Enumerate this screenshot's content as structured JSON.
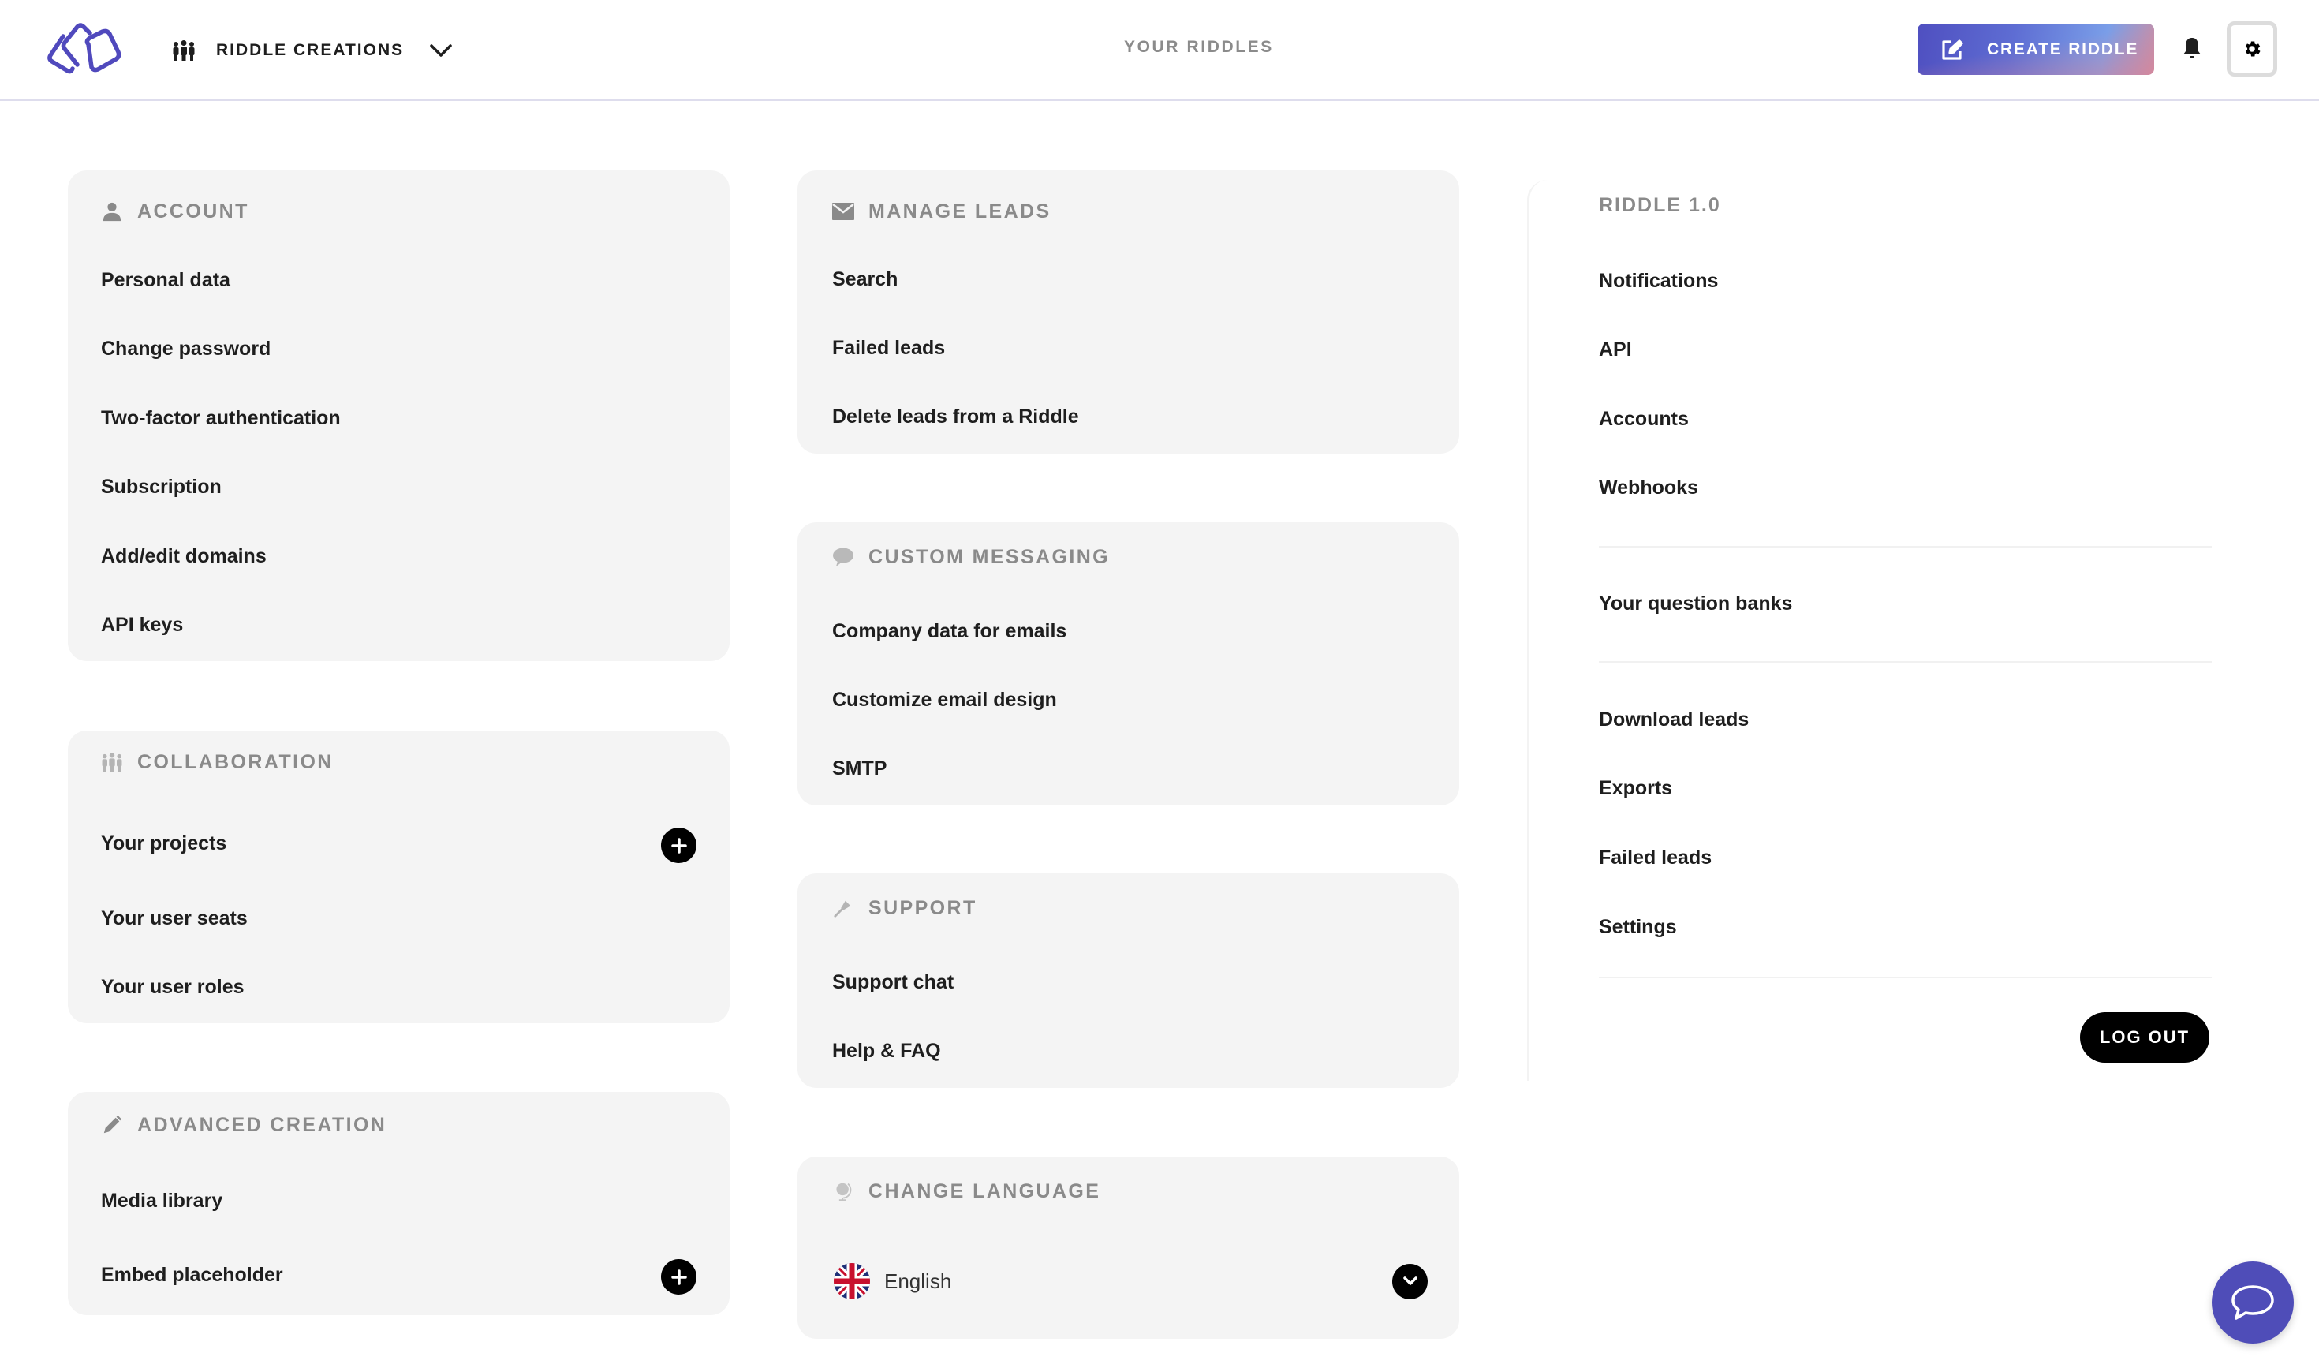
{
  "header": {
    "team_name": "RIDDLE CREATIONS",
    "nav_center": "YOUR RIDDLES",
    "create_button": "CREATE RIDDLE",
    "colors": {
      "brand": "#4f4db8",
      "gradient_start": "#4f4fc0",
      "gradient_end": "#c98fa6"
    }
  },
  "account": {
    "title": "ACCOUNT",
    "icon": "user-icon",
    "items": [
      "Personal data",
      "Change password",
      "Two-factor authentication",
      "Subscription",
      "Add/edit domains",
      "API keys"
    ]
  },
  "collaboration": {
    "title": "COLLABORATION",
    "icon": "team-icon",
    "items": [
      "Your projects",
      "Your user seats",
      "Your user roles"
    ]
  },
  "advanced_creation": {
    "title": "ADVANCED CREATION",
    "icon": "pencil-icon",
    "items": [
      "Media library",
      "Embed placeholder"
    ]
  },
  "manage_leads": {
    "title": "MANAGE LEADS",
    "icon": "envelope-icon",
    "items": [
      "Search",
      "Failed leads",
      "Delete leads from a Riddle"
    ]
  },
  "custom_messaging": {
    "title": "CUSTOM MESSAGING",
    "icon": "speech-bubble-icon",
    "items": [
      "Company data for emails",
      "Customize email design",
      "SMTP"
    ]
  },
  "support": {
    "title": "SUPPORT",
    "icon": "screwdriver-icon",
    "items": [
      "Support chat",
      "Help & FAQ"
    ]
  },
  "change_language": {
    "title": "CHANGE LANGUAGE",
    "icon": "globe-icon",
    "selected": "English",
    "flag": "uk-flag-icon"
  },
  "riddle_1": {
    "title": "RIDDLE 1.0",
    "group1": [
      "Notifications",
      "API",
      "Accounts",
      "Webhooks"
    ],
    "group2": [
      "Your question banks"
    ],
    "group3": [
      "Download leads",
      "Exports",
      "Failed leads",
      "Settings"
    ],
    "logout": "LOG OUT"
  }
}
